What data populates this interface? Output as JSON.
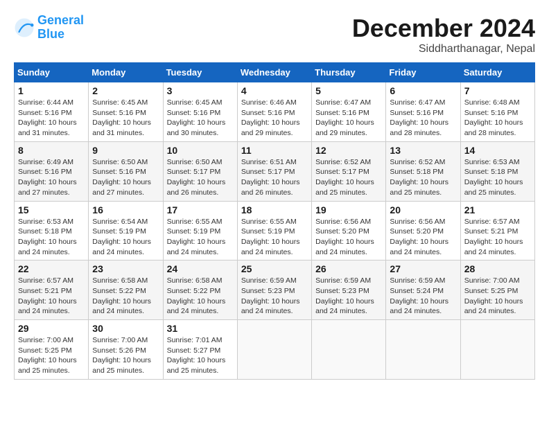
{
  "logo": {
    "line1": "General",
    "line2": "Blue"
  },
  "title": "December 2024",
  "location": "Siddharthanagar, Nepal",
  "weekdays": [
    "Sunday",
    "Monday",
    "Tuesday",
    "Wednesday",
    "Thursday",
    "Friday",
    "Saturday"
  ],
  "weeks": [
    [
      {
        "day": "1",
        "sunrise": "Sunrise: 6:44 AM",
        "sunset": "Sunset: 5:16 PM",
        "daylight": "Daylight: 10 hours and 31 minutes."
      },
      {
        "day": "2",
        "sunrise": "Sunrise: 6:45 AM",
        "sunset": "Sunset: 5:16 PM",
        "daylight": "Daylight: 10 hours and 31 minutes."
      },
      {
        "day": "3",
        "sunrise": "Sunrise: 6:45 AM",
        "sunset": "Sunset: 5:16 PM",
        "daylight": "Daylight: 10 hours and 30 minutes."
      },
      {
        "day": "4",
        "sunrise": "Sunrise: 6:46 AM",
        "sunset": "Sunset: 5:16 PM",
        "daylight": "Daylight: 10 hours and 29 minutes."
      },
      {
        "day": "5",
        "sunrise": "Sunrise: 6:47 AM",
        "sunset": "Sunset: 5:16 PM",
        "daylight": "Daylight: 10 hours and 29 minutes."
      },
      {
        "day": "6",
        "sunrise": "Sunrise: 6:47 AM",
        "sunset": "Sunset: 5:16 PM",
        "daylight": "Daylight: 10 hours and 28 minutes."
      },
      {
        "day": "7",
        "sunrise": "Sunrise: 6:48 AM",
        "sunset": "Sunset: 5:16 PM",
        "daylight": "Daylight: 10 hours and 28 minutes."
      }
    ],
    [
      {
        "day": "8",
        "sunrise": "Sunrise: 6:49 AM",
        "sunset": "Sunset: 5:16 PM",
        "daylight": "Daylight: 10 hours and 27 minutes."
      },
      {
        "day": "9",
        "sunrise": "Sunrise: 6:50 AM",
        "sunset": "Sunset: 5:16 PM",
        "daylight": "Daylight: 10 hours and 27 minutes."
      },
      {
        "day": "10",
        "sunrise": "Sunrise: 6:50 AM",
        "sunset": "Sunset: 5:17 PM",
        "daylight": "Daylight: 10 hours and 26 minutes."
      },
      {
        "day": "11",
        "sunrise": "Sunrise: 6:51 AM",
        "sunset": "Sunset: 5:17 PM",
        "daylight": "Daylight: 10 hours and 26 minutes."
      },
      {
        "day": "12",
        "sunrise": "Sunrise: 6:52 AM",
        "sunset": "Sunset: 5:17 PM",
        "daylight": "Daylight: 10 hours and 25 minutes."
      },
      {
        "day": "13",
        "sunrise": "Sunrise: 6:52 AM",
        "sunset": "Sunset: 5:18 PM",
        "daylight": "Daylight: 10 hours and 25 minutes."
      },
      {
        "day": "14",
        "sunrise": "Sunrise: 6:53 AM",
        "sunset": "Sunset: 5:18 PM",
        "daylight": "Daylight: 10 hours and 25 minutes."
      }
    ],
    [
      {
        "day": "15",
        "sunrise": "Sunrise: 6:53 AM",
        "sunset": "Sunset: 5:18 PM",
        "daylight": "Daylight: 10 hours and 24 minutes."
      },
      {
        "day": "16",
        "sunrise": "Sunrise: 6:54 AM",
        "sunset": "Sunset: 5:19 PM",
        "daylight": "Daylight: 10 hours and 24 minutes."
      },
      {
        "day": "17",
        "sunrise": "Sunrise: 6:55 AM",
        "sunset": "Sunset: 5:19 PM",
        "daylight": "Daylight: 10 hours and 24 minutes."
      },
      {
        "day": "18",
        "sunrise": "Sunrise: 6:55 AM",
        "sunset": "Sunset: 5:19 PM",
        "daylight": "Daylight: 10 hours and 24 minutes."
      },
      {
        "day": "19",
        "sunrise": "Sunrise: 6:56 AM",
        "sunset": "Sunset: 5:20 PM",
        "daylight": "Daylight: 10 hours and 24 minutes."
      },
      {
        "day": "20",
        "sunrise": "Sunrise: 6:56 AM",
        "sunset": "Sunset: 5:20 PM",
        "daylight": "Daylight: 10 hours and 24 minutes."
      },
      {
        "day": "21",
        "sunrise": "Sunrise: 6:57 AM",
        "sunset": "Sunset: 5:21 PM",
        "daylight": "Daylight: 10 hours and 24 minutes."
      }
    ],
    [
      {
        "day": "22",
        "sunrise": "Sunrise: 6:57 AM",
        "sunset": "Sunset: 5:21 PM",
        "daylight": "Daylight: 10 hours and 24 minutes."
      },
      {
        "day": "23",
        "sunrise": "Sunrise: 6:58 AM",
        "sunset": "Sunset: 5:22 PM",
        "daylight": "Daylight: 10 hours and 24 minutes."
      },
      {
        "day": "24",
        "sunrise": "Sunrise: 6:58 AM",
        "sunset": "Sunset: 5:22 PM",
        "daylight": "Daylight: 10 hours and 24 minutes."
      },
      {
        "day": "25",
        "sunrise": "Sunrise: 6:59 AM",
        "sunset": "Sunset: 5:23 PM",
        "daylight": "Daylight: 10 hours and 24 minutes."
      },
      {
        "day": "26",
        "sunrise": "Sunrise: 6:59 AM",
        "sunset": "Sunset: 5:23 PM",
        "daylight": "Daylight: 10 hours and 24 minutes."
      },
      {
        "day": "27",
        "sunrise": "Sunrise: 6:59 AM",
        "sunset": "Sunset: 5:24 PM",
        "daylight": "Daylight: 10 hours and 24 minutes."
      },
      {
        "day": "28",
        "sunrise": "Sunrise: 7:00 AM",
        "sunset": "Sunset: 5:25 PM",
        "daylight": "Daylight: 10 hours and 24 minutes."
      }
    ],
    [
      {
        "day": "29",
        "sunrise": "Sunrise: 7:00 AM",
        "sunset": "Sunset: 5:25 PM",
        "daylight": "Daylight: 10 hours and 25 minutes."
      },
      {
        "day": "30",
        "sunrise": "Sunrise: 7:00 AM",
        "sunset": "Sunset: 5:26 PM",
        "daylight": "Daylight: 10 hours and 25 minutes."
      },
      {
        "day": "31",
        "sunrise": "Sunrise: 7:01 AM",
        "sunset": "Sunset: 5:27 PM",
        "daylight": "Daylight: 10 hours and 25 minutes."
      },
      null,
      null,
      null,
      null
    ]
  ]
}
